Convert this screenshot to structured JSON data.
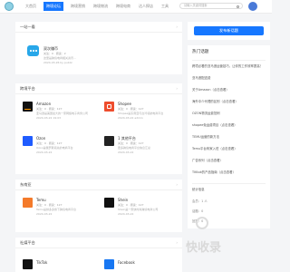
{
  "header": {
    "nav": [
      "大首页",
      "跨境论坛",
      "跨境营销",
      "跨境物流",
      "跨境电商",
      "达人探店",
      "工具"
    ],
    "active_nav": 1,
    "search_placeholder": "请输入关键词搜索"
  },
  "colors": {
    "accent": "#1677ff",
    "background": "#f4f5f7"
  },
  "sections": {
    "one": {
      "title": "一站一看",
      "items": [
        {
          "name": "双次赚币",
          "stats": "关注：0 · 阅读：2",
          "desc": "这里是跨境电商相关资讯...",
          "meta": "2024-03-26 by public",
          "icon": "chat-bubble-icon",
          "icon_color": "#28a7e9"
        }
      ]
    },
    "two": {
      "title": "跨境平台",
      "items": [
        {
          "name": "Amazon",
          "stats": "关注：0 · 阅读：127",
          "desc": "亚马逊是美国最大的一家网络电子商务公司",
          "meta": "2024-03-22 19:03",
          "icon": "amazon-logo-icon",
          "icon_color": "#111111"
        },
        {
          "name": "Shopee",
          "stats": "关注：0 · 阅读：127",
          "desc": "Shopee是东南亚与台湾领航电商平台",
          "meta": "2024-03-22 admin",
          "icon": "shopee-bag-icon",
          "icon_color": "#ee4d2d"
        },
        {
          "name": "Ozon",
          "stats": "关注：0 · 阅读：127",
          "desc": "Ozon是俄罗斯领先的电商平台",
          "meta": "2024-03-22",
          "icon": "ozon-logo-icon",
          "icon_color": "#1f5cff"
        },
        {
          "name": "1 其他平台",
          "stats": "关注：0 · 阅读：127",
          "desc": "更多跨境电商平台信息汇总",
          "meta": "2024-03-22",
          "icon": "grid-icon",
          "icon_color": "#222222"
        }
      ]
    },
    "three": {
      "title": "东南亚",
      "items": [
        {
          "name": "Temu",
          "stats": "关注：0 · 阅读：127",
          "desc": "Temu是拼多多旗下跨境电商平台",
          "meta": "2024-03-22",
          "icon": "temu-logo-icon",
          "icon_color": "#f47a2a"
        },
        {
          "name": "Shein",
          "stats": "关注：0 · 阅读：127",
          "desc": "Shein是一家快时尚跨境电商公司",
          "meta": "2024-03-22",
          "icon": "shein-logo-icon",
          "icon_color": "#111111"
        }
      ]
    },
    "four": {
      "title": "社媒平台",
      "items": [
        {
          "name": "TikTok",
          "icon": "tiktok-logo-icon",
          "icon_color": "#111111"
        },
        {
          "name": "Facebook",
          "icon": "facebook-logo-icon",
          "icon_color": "#1877f2"
        }
      ]
    }
  },
  "sidebar": {
    "cta_label": "发布新话题",
    "hot_title": "热门话题",
    "hot_items": [
      "跨境必看的亚马逊运营技巧，让你的工作效率提高！",
      "亚马逊配送费",
      "关于Amazon（点击查看）",
      "海外中介代理的区别（点击查看）",
      "OZON物流运费范例",
      "shopee免运费项目（点击查看）",
      "TEMU运营的新方法",
      "Temu平台商家入驻（点击查看）",
      "广告系列（点击查看）",
      "TIKtok的产品指南（点击查看）"
    ],
    "stats_title": "统计信息",
    "stats": [
      "会员：1 人",
      "话题：0",
      "回复：0"
    ]
  },
  "watermark": "快收录"
}
